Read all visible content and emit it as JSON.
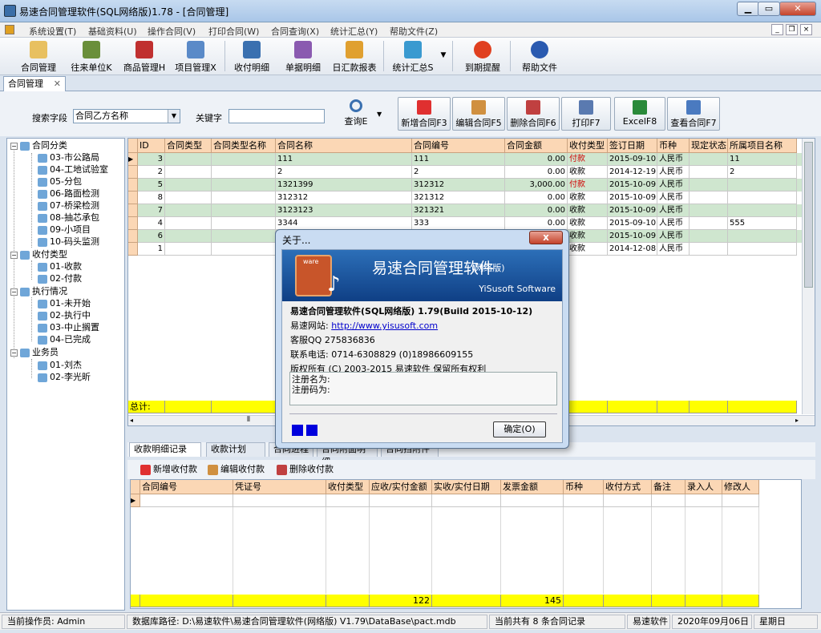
{
  "window": {
    "title": "易速合同管理软件(SQL网络版)1.78 - [合同管理]"
  },
  "menu": [
    "系统设置(T)",
    "基础资料(U)",
    "操作合同(V)",
    "打印合同(W)",
    "合同查询(X)",
    "统计汇总(Y)",
    "帮助文件(Z)"
  ],
  "toolbar": [
    "合同管理",
    "往来单位K",
    "商品管理H",
    "项目管理X",
    "收付明细",
    "单据明细",
    "日汇款报表",
    "统计汇总S",
    "到期提醒",
    "帮助文件"
  ],
  "tab": {
    "label": "合同管理"
  },
  "search": {
    "field_label": "搜索字段",
    "field_value": "合同乙方名称",
    "keyword_label": "关键字",
    "keyword_value": "",
    "query_label": "查询E"
  },
  "actions": [
    "新增合同F3",
    "编辑合同F5",
    "删除合同F6",
    "打印F7",
    "ExcelF8",
    "查看合同F7"
  ],
  "tree": {
    "groups": [
      {
        "label": "合同分类",
        "children": [
          "03-市公路局",
          "04-工地试验室",
          "05-分包",
          "06-路面检测",
          "07-桥梁检测",
          "08-抽芯承包",
          "09-小项目",
          "10-码头监测"
        ]
      },
      {
        "label": "收付类型",
        "children": [
          "01-收款",
          "02-付款"
        ]
      },
      {
        "label": "执行情况",
        "children": [
          "01-未开始",
          "02-执行中",
          "03-中止搁置",
          "04-已完成"
        ]
      },
      {
        "label": "业务员",
        "children": [
          "01-刘杰",
          "02-李光昕"
        ]
      }
    ]
  },
  "grid": {
    "columns": [
      "ID",
      "合同类型",
      "合同类型名称",
      "合同名称",
      "合同编号",
      "合同金额",
      "收付类型",
      "签订日期",
      "币种",
      "现定状态",
      "所属项目名称"
    ],
    "rows": [
      [
        "3",
        "",
        "",
        "111",
        "111",
        "0.00",
        "付款",
        "2015-09-10",
        "人民币",
        "",
        "11"
      ],
      [
        "2",
        "",
        "",
        "2",
        "2",
        "0.00",
        "收款",
        "2014-12-19",
        "人民币",
        "",
        "2"
      ],
      [
        "5",
        "",
        "",
        "1321399",
        "312312",
        "3,000.00",
        "付款",
        "2015-10-09",
        "人民币",
        "",
        ""
      ],
      [
        "8",
        "",
        "",
        "312312",
        "321312",
        "0.00",
        "收款",
        "2015-10-09",
        "人民币",
        "",
        ""
      ],
      [
        "7",
        "",
        "",
        "3123123",
        "321321",
        "0.00",
        "收款",
        "2015-10-09",
        "人民币",
        "",
        ""
      ],
      [
        "4",
        "",
        "",
        "3344",
        "333",
        "0.00",
        "收款",
        "2015-09-10",
        "人民币",
        "",
        "555"
      ],
      [
        "6",
        "",
        "",
        "",
        "",
        "",
        "收款",
        "2015-10-09",
        "人民币",
        "",
        ""
      ],
      [
        "1",
        "",
        "",
        "",
        "",
        "",
        "收款",
        "2014-12-08",
        "人民币",
        "",
        ""
      ]
    ],
    "total_label": "总计:"
  },
  "subtabs": [
    "收款明细记录",
    "收款计划",
    "合同进程",
    "合同附面明细",
    "合同挡附件"
  ],
  "subactions": [
    "新增收付款",
    "编辑收付款",
    "删除收付款"
  ],
  "grid2": {
    "columns": [
      "合同编号",
      "凭证号",
      "收付类型",
      "应收/实付金额",
      "实收/实付日期",
      "发票金额",
      "币种",
      "收付方式",
      "备注",
      "录入人",
      "修改人"
    ],
    "totals": {
      "c4": "122",
      "c6": "145"
    }
  },
  "dialog": {
    "title": "关于...",
    "close": "x",
    "banner_title": "易速合同管理软件",
    "banner_suffix": "(网络版)",
    "banner_sub": "YiSusoft Software",
    "logo_text": "ware",
    "product": "易速合同管理软件(SQL网络版) 1.79(Build 2015-10-12)",
    "site_label": "易速网站:",
    "site_url": "http://www.yisusoft.com",
    "qq": "客服QQ 275836836",
    "phone": "联系电话: 0714-6308829  (0)18986609155",
    "copyright": "版权所有 (C) 2003-2015 易速软件 保留所有权利",
    "reg_name": "注册名为:",
    "reg_code": "注册码为:",
    "ok": "确定(O)"
  },
  "status": {
    "operator": "当前操作员: Admin",
    "db": "数据库路径: D:\\易速软件\\易速合同管理软件(网络版) V1.79\\DataBase\\pact.mdb",
    "count": "当前共有 8 条合同记录",
    "company": "易速软件",
    "date": "2020年09月06日",
    "weekday": "星期日"
  }
}
